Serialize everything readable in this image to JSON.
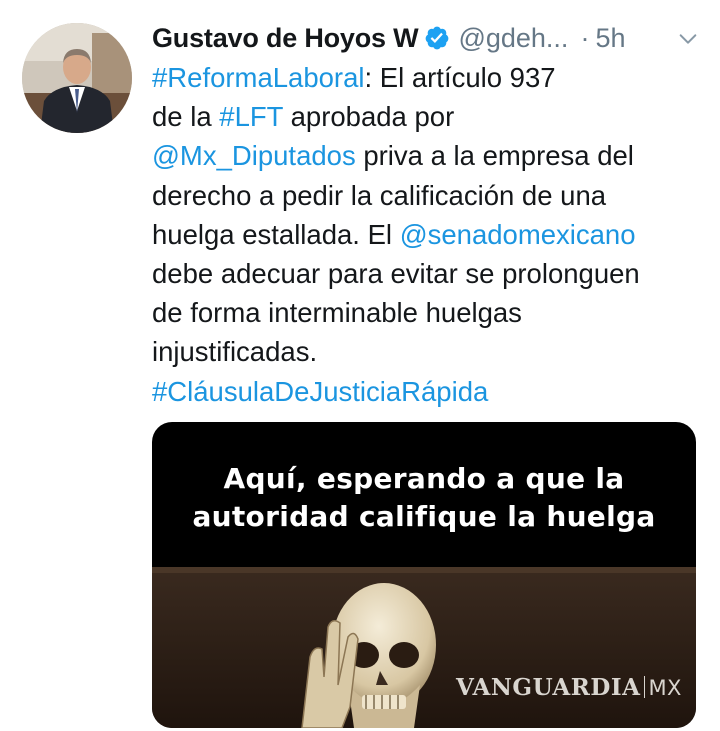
{
  "tweet": {
    "author": {
      "display_name": "Gustavo de Hoyos W",
      "handle": "@gdeh...",
      "verified": true,
      "avatar_icon": "profile-photo"
    },
    "separator": "·",
    "time": "5h",
    "menu_icon": "chevron-down-icon",
    "text_lines": [
      [
        {
          "t": "#ReformaLaboral",
          "link": true
        },
        {
          "t": ": El artículo 937"
        }
      ],
      [
        {
          "t": "de la "
        },
        {
          "t": "#LFT",
          "link": true
        },
        {
          "t": " aprobada por"
        }
      ],
      [
        {
          "t": "@Mx_Diputados",
          "link": true
        },
        {
          "t": " priva a la empresa del"
        }
      ],
      [
        {
          "t": "derecho a pedir la calificación de una"
        }
      ],
      [
        {
          "t": "huelga estallada. El "
        },
        {
          "t": "@senadomexicano",
          "link": true
        }
      ],
      [
        {
          "t": "debe adecuar para evitar se prolonguen"
        }
      ],
      [
        {
          "t": "de forma interminable huelgas"
        }
      ],
      [
        {
          "t": "injustificadas."
        }
      ],
      [
        {
          "t": "#CláusulaDeJusticiaRápida",
          "link": true
        }
      ]
    ],
    "media": {
      "caption_lines": [
        "Aquí, esperando a que la",
        "autoridad califique la huelga"
      ],
      "watermark": "VANGUARDIA",
      "watermark_suffix": "MX"
    }
  },
  "colors": {
    "link": "#1b95e0",
    "text": "#14171a",
    "secondary": "#657786",
    "verified": "#1da1f2"
  }
}
